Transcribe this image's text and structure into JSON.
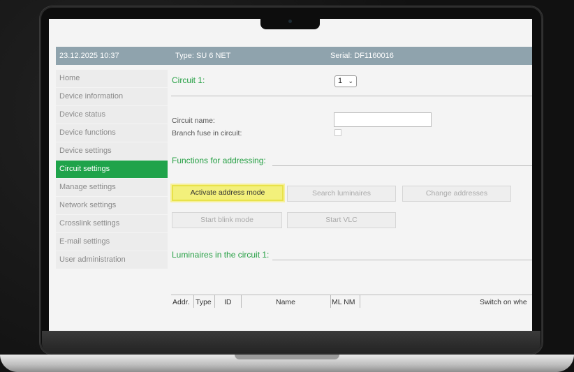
{
  "status_bar": {
    "datetime": "23.12.2025 10:37",
    "type": "Type: SU 6 NET",
    "serial": "Serial: DF1160016"
  },
  "sidebar": {
    "items": [
      {
        "label": "Home"
      },
      {
        "label": "Device information"
      },
      {
        "label": "Device status"
      },
      {
        "label": "Device functions"
      },
      {
        "label": "Device settings"
      },
      {
        "label": "Circuit settings",
        "active": true
      },
      {
        "label": "Manage settings"
      },
      {
        "label": "Network settings"
      },
      {
        "label": "Crosslink settings"
      },
      {
        "label": "E-mail settings"
      },
      {
        "label": "User administration"
      }
    ]
  },
  "circuit": {
    "title": "Circuit 1:",
    "selected": "1",
    "name_label": "Circuit name:",
    "name_value": "",
    "branch_fuse_label": "Branch fuse in circuit:",
    "branch_fuse_checked": false
  },
  "addressing": {
    "title": "Functions for addressing:",
    "buttons": {
      "activate": "Activate address mode",
      "search": "Search luminaires",
      "change": "Change addresses",
      "blink": "Start blink mode",
      "vlc": "Start VLC"
    }
  },
  "luminaires": {
    "title": "Luminaires in the circuit 1:",
    "columns": [
      "Addr.",
      "Type",
      "ID",
      "Name",
      "ML NM",
      "Switch on whe"
    ]
  },
  "colors": {
    "accent_green": "#1fa34a",
    "header_bg": "#8fa3ad",
    "highlight_yellow": "#f3f07b"
  }
}
